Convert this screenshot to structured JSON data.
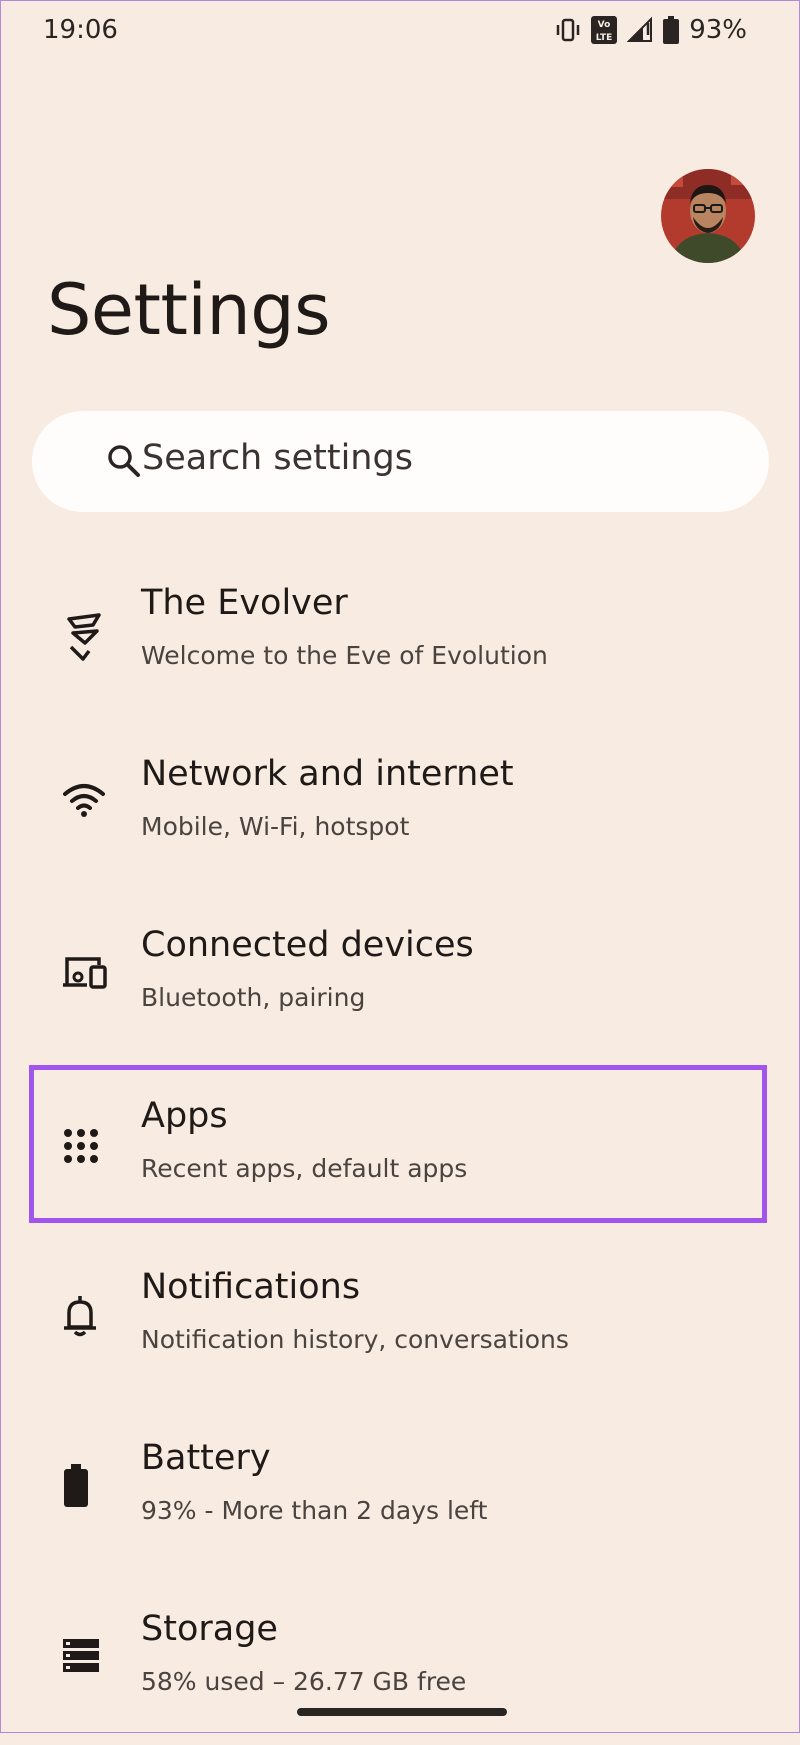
{
  "status_bar": {
    "time": "19:06",
    "volte_label": "Vo LTE",
    "battery_percent": "93%",
    "icons": [
      "vibrate-icon",
      "volte-icon",
      "signal-icon",
      "battery-icon"
    ]
  },
  "header": {
    "title": "Settings"
  },
  "search": {
    "placeholder": "Search settings"
  },
  "items": [
    {
      "title": "The Evolver",
      "subtitle": "Welcome to the Eve of Evolution",
      "icon": "evolver-logo-icon"
    },
    {
      "title": "Network and internet",
      "subtitle": "Mobile, Wi-Fi, hotspot",
      "icon": "wifi-icon"
    },
    {
      "title": "Connected devices",
      "subtitle": "Bluetooth, pairing",
      "icon": "connected-devices-icon"
    },
    {
      "title": "Apps",
      "subtitle": "Recent apps, default apps",
      "icon": "apps-grid-icon"
    },
    {
      "title": "Notifications",
      "subtitle": "Notification history, conversations",
      "icon": "bell-icon"
    },
    {
      "title": "Battery",
      "subtitle": "93% - More than 2 days left",
      "icon": "battery-icon"
    },
    {
      "title": "Storage",
      "subtitle": "58% used – 26.77 GB free",
      "icon": "storage-icon"
    }
  ],
  "highlight": {
    "item": "Apps",
    "color": "#a255ec"
  },
  "colors": {
    "background": "#f8ece2",
    "search_background": "#fffdfb",
    "text": "#1f1a17"
  }
}
